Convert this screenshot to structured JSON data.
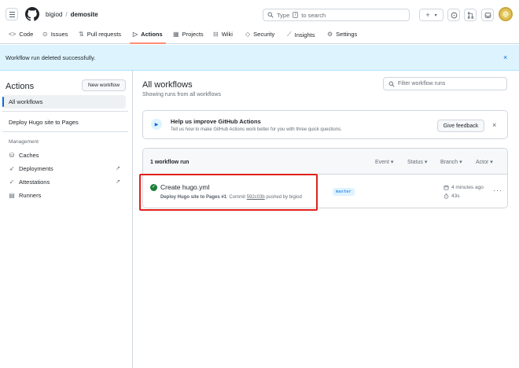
{
  "header": {
    "owner": "bigiod",
    "separator": "/",
    "repo": "demosite",
    "search_placeholder": "Type",
    "search_kbd": "/",
    "search_suffix": "to search",
    "plus_label": "+",
    "caret": "▾"
  },
  "tabs": [
    {
      "label": "Code",
      "icon": "code-icon"
    },
    {
      "label": "Issues",
      "icon": "issue-icon"
    },
    {
      "label": "Pull requests",
      "icon": "pull-request-icon"
    },
    {
      "label": "Actions",
      "icon": "play-icon"
    },
    {
      "label": "Projects",
      "icon": "table-icon"
    },
    {
      "label": "Wiki",
      "icon": "book-icon"
    },
    {
      "label": "Security",
      "icon": "shield-icon"
    },
    {
      "label": "Insights",
      "icon": "graph-icon"
    },
    {
      "label": "Settings",
      "icon": "gear-icon"
    }
  ],
  "flash": {
    "message": "Workflow run deleted successfully.",
    "close": "×"
  },
  "sidebar": {
    "title": "Actions",
    "new_workflow": "New workflow",
    "all_workflows": "All workflows",
    "workflow": "Deploy Hugo site to Pages",
    "management_heading": "Management",
    "items": [
      {
        "label": "Caches",
        "icon": "database-icon"
      },
      {
        "label": "Deployments",
        "icon": "rocket-icon"
      },
      {
        "label": "Attestations",
        "icon": "verified-icon"
      },
      {
        "label": "Runners",
        "icon": "server-icon"
      }
    ],
    "external_glyph": "↗"
  },
  "main": {
    "title": "All workflows",
    "subtitle": "Showing runs from all workflows",
    "filter_placeholder": "Filter workflow runs",
    "banner": {
      "title": "Help us improve GitHub Actions",
      "description": "Tell us how to make GitHub Actions work better for you with three quick questions.",
      "button": "Give feedback",
      "close": "×"
    },
    "runs": {
      "count": "1 workflow run",
      "filters": [
        "Event",
        "Status",
        "Branch",
        "Actor"
      ],
      "run": {
        "title": "Create hugo.yml",
        "workflow": "Deploy Hugo site to Pages",
        "number": "#1",
        "commit_prefix": ": Commit",
        "commit_sha": "592c03b",
        "pushed_by": "pushed by bigiod",
        "branch": "master",
        "time": "4 minutes ago",
        "duration": "43s",
        "status": "success"
      }
    }
  },
  "colors": {
    "accent": "#0969da",
    "success": "#1a7f37",
    "highlight": "#e0211a",
    "flash_bg": "#ddf4ff",
    "tab_underline": "#fd8c73"
  }
}
